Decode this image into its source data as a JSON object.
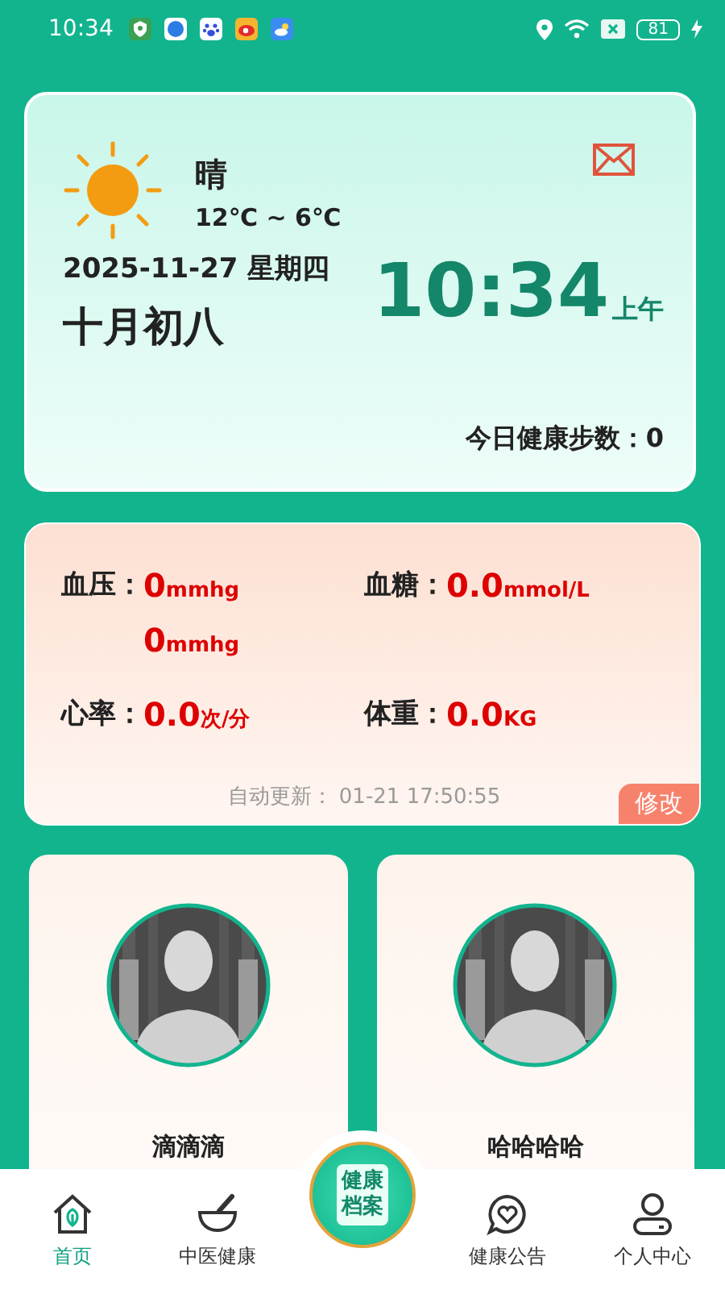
{
  "status_bar": {
    "time": "10:34",
    "battery": "81"
  },
  "weather": {
    "condition": "晴",
    "temperature": "12℃ ~ 6℃",
    "date": "2025-11-27 星期四",
    "lunar_date": "十月初八",
    "time": "10:34",
    "period": "上午",
    "steps_label": "今日健康步数：",
    "steps": "0"
  },
  "health": {
    "metrics": [
      {
        "label": "血压：",
        "values": [
          {
            "value": "0",
            "unit": "mmhg"
          },
          {
            "value": "0",
            "unit": "mmhg"
          }
        ]
      },
      {
        "label": "血糖：",
        "values": [
          {
            "value": "0.0",
            "unit": "mmol/L"
          }
        ]
      },
      {
        "label": "心率：",
        "values": [
          {
            "value": "0.0",
            "unit": "次/分"
          }
        ]
      },
      {
        "label": "体重：",
        "values": [
          {
            "value": "0.0",
            "unit": "KG"
          }
        ]
      }
    ],
    "update_label": "自动更新：",
    "update_time": "01-21 17:50:55",
    "edit_button": "修改"
  },
  "members": [
    {
      "name": "滴滴滴"
    },
    {
      "name": "哈哈哈哈"
    }
  ],
  "nav": [
    {
      "kind": "tab",
      "label": "首页",
      "selected": true
    },
    {
      "kind": "tab",
      "label": "中医健康",
      "selected": false
    },
    {
      "kind": "badge",
      "label": "健康档案",
      "selected": false
    },
    {
      "kind": "tab",
      "label": "健康公告",
      "selected": false
    },
    {
      "kind": "tab",
      "label": "个人中心",
      "selected": false
    }
  ]
}
